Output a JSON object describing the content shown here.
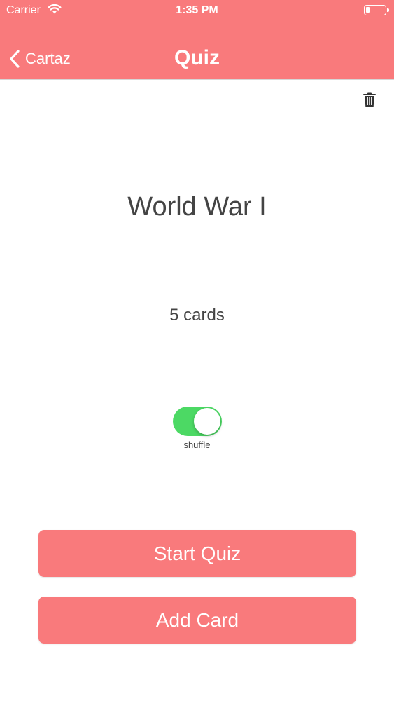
{
  "status_bar": {
    "carrier": "Carrier",
    "time": "1:35 PM",
    "battery_level": 0.2
  },
  "nav": {
    "back_label": "Cartaz",
    "title": "Quiz"
  },
  "deck": {
    "title": "World War I",
    "count_label": "5 cards"
  },
  "shuffle": {
    "label": "shuffle",
    "on": true
  },
  "actions": {
    "start_label": "Start Quiz",
    "add_label": "Add Card"
  },
  "colors": {
    "accent": "#f97a7c",
    "toggle_on": "#4cd964",
    "text": "#444444"
  },
  "icons": {
    "back": "chevron-left-icon",
    "trash": "trash-icon",
    "wifi": "wifi-icon",
    "battery": "battery-icon"
  }
}
